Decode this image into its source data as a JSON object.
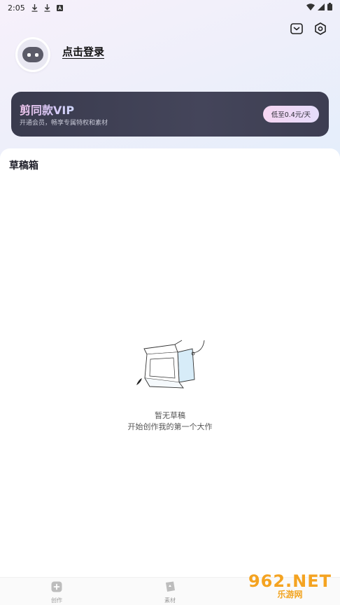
{
  "status_bar": {
    "time": "2:05"
  },
  "profile": {
    "login_label": "点击登录"
  },
  "vip": {
    "title": "剪同款VIP",
    "subtitle": "开通会员，畅享专属特权和素材",
    "price_label": "低至0.4元/天"
  },
  "drafts": {
    "section_title": "草稿箱",
    "empty_title": "暂无草稿",
    "empty_subtitle": "开始创作我的第一个大作"
  },
  "bottom_nav": {
    "items": [
      {
        "label": "创作",
        "icon": "create-plus-icon"
      },
      {
        "label": "素材",
        "icon": "material-icon"
      }
    ]
  },
  "watermark": {
    "top": "962.NET",
    "bottom": "乐游网"
  },
  "colors": {
    "vip_card": "#3a3b4e",
    "vip_title_gradient_start": "#f2c7ef",
    "price_pill": "#f6d6f2"
  }
}
